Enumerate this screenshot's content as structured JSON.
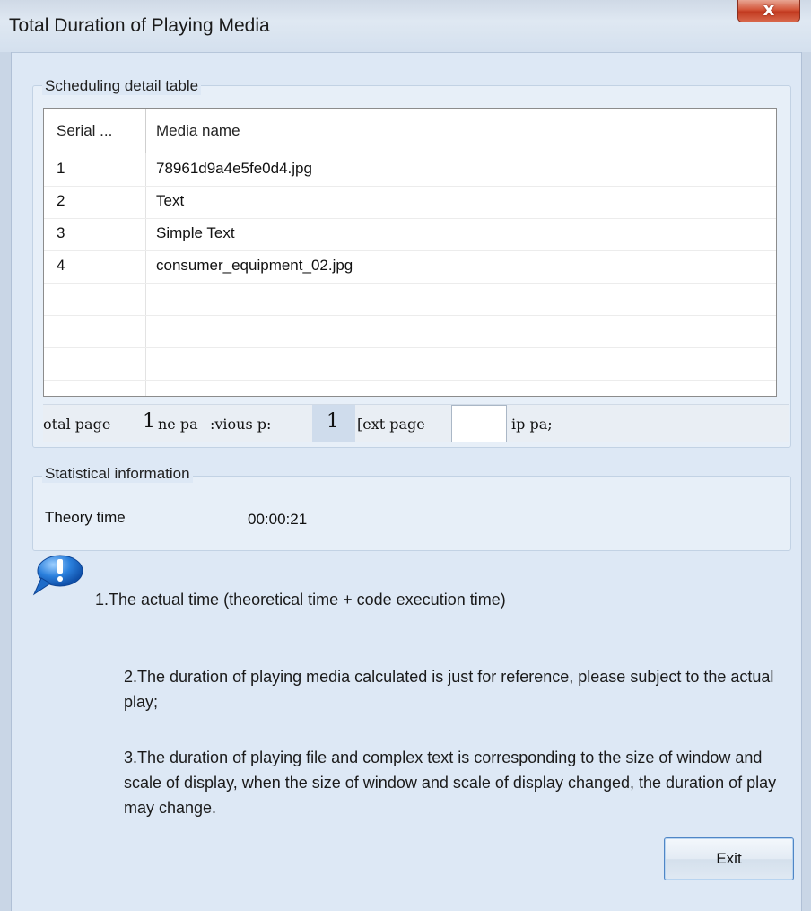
{
  "window": {
    "title": "Total Duration of Playing Media",
    "close_glyph": "x"
  },
  "schedule": {
    "group_label": "Scheduling detail table",
    "columns": [
      "Serial ...",
      "Media name"
    ],
    "rows": [
      {
        "serial": "1",
        "media": "78961d9a4e5fe0d4.jpg"
      },
      {
        "serial": "2",
        "media": "Text"
      },
      {
        "serial": "3",
        "media": "Simple Text"
      },
      {
        "serial": "4",
        "media": "consumer_equipment_02.jpg"
      }
    ]
  },
  "pager": {
    "total_label": "otal page",
    "total_value": "1",
    "home_label": "ne pa",
    "previous_label": ":vious p:",
    "current_page": "1",
    "next_label": "[ext page",
    "goto_value": "",
    "stop_label": "ip pa;"
  },
  "stats": {
    "group_label": "Statistical information",
    "theory_label": "Theory time",
    "theory_value": "00:00:21"
  },
  "notes": {
    "icon": "info-bubble-icon",
    "note1": "1.The actual time (theoretical time + code execution time)",
    "note2": "2.The duration of playing media calculated is just for reference, please subject to the actual play;",
    "note3": "3.The duration of playing file and complex text is corresponding to the size of window and scale of display, when the size of window and scale of display changed, the duration of play may change."
  },
  "actions": {
    "exit_label": "Exit"
  },
  "colors": {
    "dialog_background": "#dde8f5",
    "close_button": "#c23a20",
    "button_border": "#4f86c6"
  }
}
